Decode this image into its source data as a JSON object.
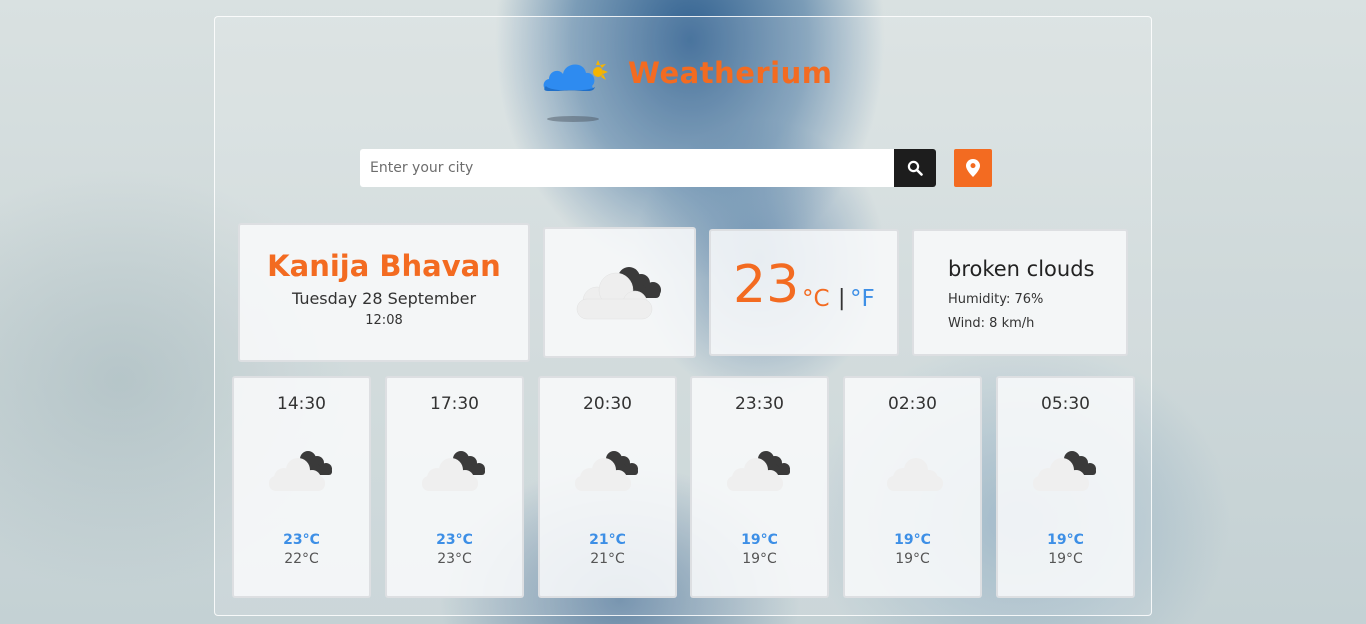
{
  "app": {
    "name": "Weatherium",
    "logo_icon": "cloud-sun-icon"
  },
  "search": {
    "placeholder": "Enter your city",
    "value": "",
    "search_icon": "search-icon",
    "location_icon": "map-marker-icon"
  },
  "current": {
    "city": "Kanija Bhavan",
    "date": "Tuesday 28 September",
    "time": "12:08",
    "icon": "cloud-moon-icon",
    "temperature": "23",
    "unit_c": "°C",
    "unit_separator": "|",
    "unit_f": "°F",
    "description": "broken clouds",
    "humidity": "Humidity: 76%",
    "wind": "Wind: 8 km/h"
  },
  "forecast": [
    {
      "time": "14:30",
      "icon": "cloud-moon-icon",
      "max": "23°C",
      "min": "22°C"
    },
    {
      "time": "17:30",
      "icon": "cloud-moon-icon",
      "max": "23°C",
      "min": "23°C"
    },
    {
      "time": "20:30",
      "icon": "cloud-moon-icon",
      "max": "21°C",
      "min": "21°C"
    },
    {
      "time": "23:30",
      "icon": "cloud-moon-icon",
      "max": "19°C",
      "min": "19°C"
    },
    {
      "time": "02:30",
      "icon": "cloud-icon",
      "max": "19°C",
      "min": "19°C"
    },
    {
      "time": "05:30",
      "icon": "cloud-moon-icon",
      "max": "19°C",
      "min": "19°C"
    }
  ],
  "colors": {
    "accent": "#f36b21",
    "blue": "#3d8fe6",
    "dark": "#1d1d1d"
  }
}
